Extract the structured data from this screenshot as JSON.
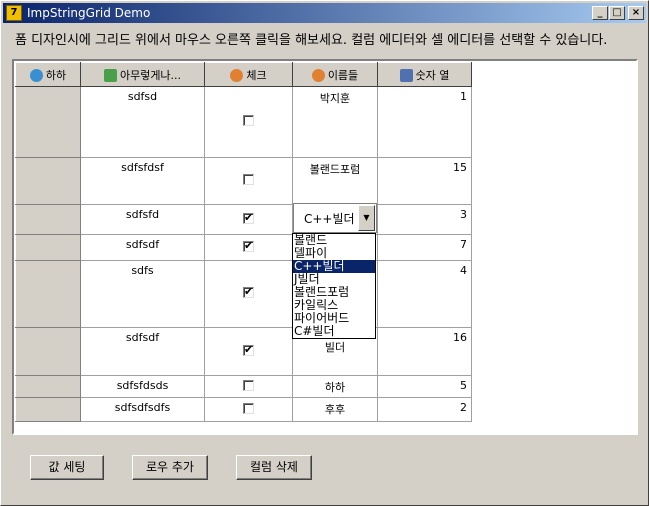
{
  "window": {
    "title": "ImpStringGrid Demo",
    "icon_name": "delphi-app-icon"
  },
  "titlebar_buttons": {
    "minimize": "_",
    "maximize": "□",
    "close": "×"
  },
  "hint": "폼 디자인시에 그리드 위에서 마우스 오른쪽 클릭을 해보세요. 컬럼 에디터와 셀 에디터를 선택할 수 있습니다.",
  "grid": {
    "columns": [
      {
        "label": "하하",
        "icon": "globe-user-icon",
        "icon_color": "#3a8fd0"
      },
      {
        "label": "아무렇게나...",
        "icon": "home-icon",
        "icon_color": "#4aa04a"
      },
      {
        "label": "체크",
        "icon": "user-icon",
        "icon_color": "#e08030"
      },
      {
        "label": "이름들",
        "icon": "user-icon",
        "icon_color": "#e08030"
      },
      {
        "label": "숫자 열",
        "icon": "phone-icon",
        "icon_color": "#5070b0"
      }
    ],
    "rows": [
      {
        "text": "sdfsd",
        "checked": false,
        "name": "박지훈",
        "number": "1"
      },
      {
        "text": "sdfsfdsf",
        "checked": false,
        "name": "볼랜드포럼",
        "number": "15"
      },
      {
        "text": "sdfsfd",
        "checked": true,
        "name": "",
        "number": "3"
      },
      {
        "text": "sdfsdf",
        "checked": true,
        "name": "",
        "number": "7"
      },
      {
        "text": "sdfs",
        "checked": true,
        "name": "",
        "number": "4"
      },
      {
        "text": "sdfsdf",
        "checked": true,
        "name": "빌더",
        "number": "16"
      },
      {
        "text": "sdfsfdsds",
        "checked": false,
        "name": "하하",
        "number": "5"
      },
      {
        "text": "sdfsdfsdfs",
        "checked": false,
        "name": "후후",
        "number": "2"
      }
    ]
  },
  "combo": {
    "value": "C++빌더",
    "options": [
      "볼랜드",
      "델파이",
      "C++빌더",
      "J빌더",
      "볼랜드포럼",
      "카일릭스",
      "파이어버드",
      "C#빌더"
    ],
    "selected_index": 2
  },
  "buttons": {
    "set_value": "값 세팅",
    "add_row": "로우 추가",
    "delete_column": "컬럼 삭제"
  }
}
